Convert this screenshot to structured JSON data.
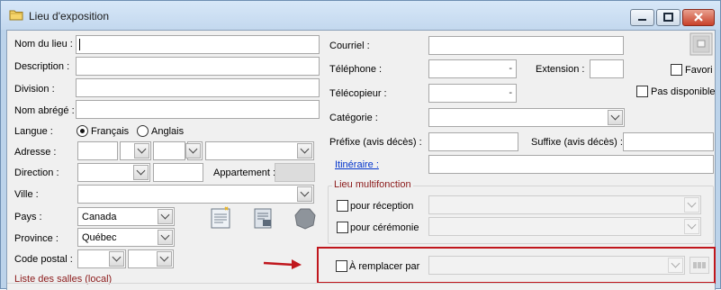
{
  "window": {
    "title": "Lieu d'exposition",
    "icon": "folder-icon",
    "controls": [
      "minimize-icon",
      "maximize-icon",
      "close-icon"
    ]
  },
  "left": {
    "nom_du_lieu_label": "Nom du lieu :",
    "description_label": "Description :",
    "division_label": "Division :",
    "nom_abrege_label": "Nom abrégé :",
    "langue_label": "Langue :",
    "langue_fr": "Français",
    "langue_en": "Anglais",
    "adresse_label": "Adresse :",
    "direction_label": "Direction :",
    "appartement_label": "Appartement :",
    "ville_label": "Ville :",
    "pays_label": "Pays :",
    "pays_value": "Canada",
    "province_label": "Province :",
    "province_value": "Québec",
    "code_postal_label": "Code postal :",
    "liste_salles_label": "Liste des salles (local)"
  },
  "right": {
    "courriel_label": "Courriel :",
    "telephone_label": "Téléphone :",
    "extension_label": "Extension :",
    "favori_label": "Favori",
    "telecopieur_label": "Télécopieur :",
    "pas_disponible_label": "Pas disponible",
    "categorie_label": "Catégorie :",
    "prefixe_label": "Préfixe (avis décès) :",
    "suffixe_label": "Suffixe (avis décès) :",
    "itineraire_label": "Itinéraire :",
    "multifonction_title": "Lieu multifonction",
    "pour_reception_label": "pour réception",
    "pour_ceremonie_label": "pour cérémonie",
    "a_remplacer_label": "À remplacer par",
    "dash": "-"
  },
  "colors": {
    "window_frame": "#bcd3ea",
    "client_bg": "#f0f0f0",
    "link": "#0033cc",
    "group_title": "#8b1a1a",
    "highlight_box": "#c0171d",
    "arrow": "#c0171d"
  },
  "icons": [
    "print-document-icon",
    "print-preview-icon",
    "stamp-icon",
    "photo-icon",
    "red-arrow-icon",
    "lookup-button-icon"
  ]
}
